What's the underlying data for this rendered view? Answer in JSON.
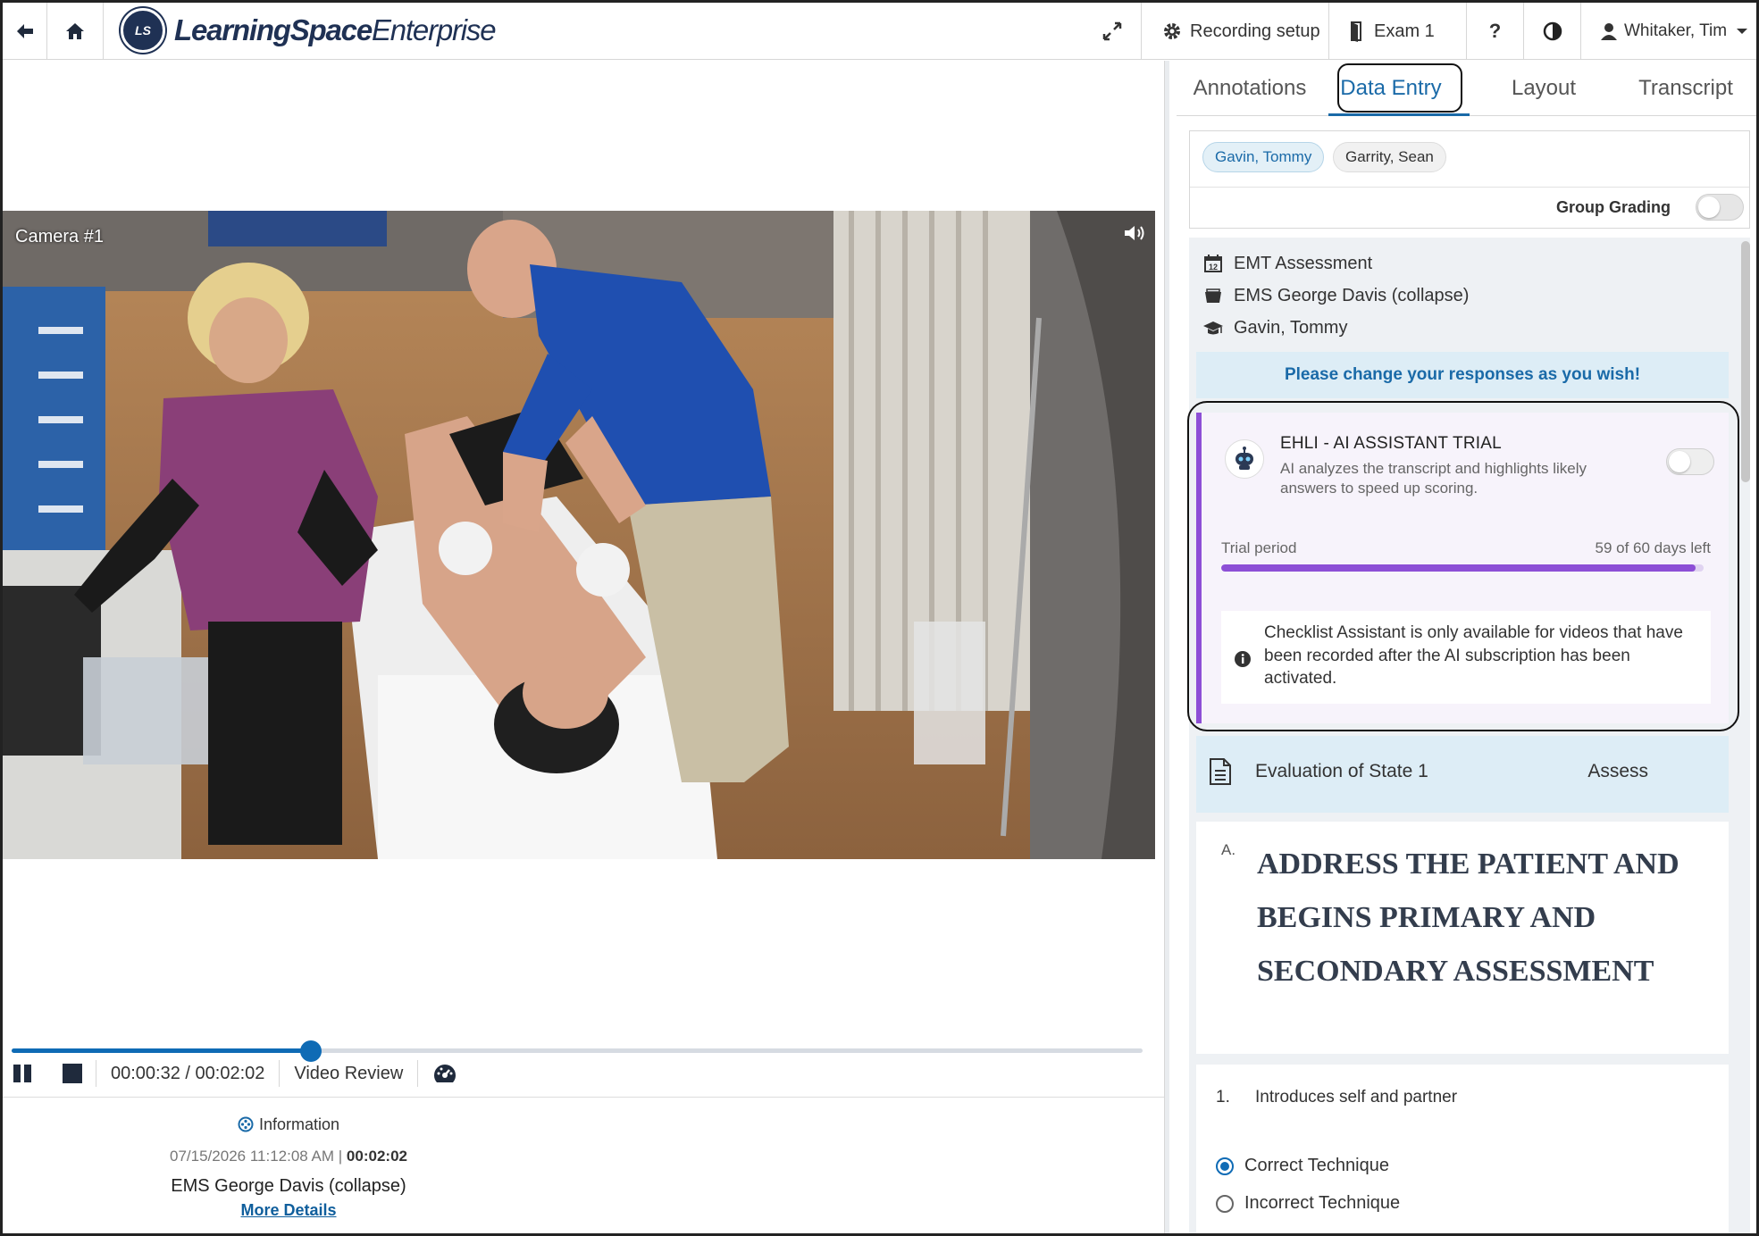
{
  "app": {
    "logo_badge": "LS",
    "logo_name_bold": "LearningSpace",
    "logo_name_light": "Enterprise"
  },
  "topbar": {
    "recording_setup": "Recording setup",
    "exam": "Exam 1",
    "help": "?",
    "user": "Whitaker, Tim"
  },
  "video": {
    "camera_label": "Camera #1",
    "progress": 0.265,
    "time_display": "00:00:32 / 00:02:02",
    "mode": "Video Review"
  },
  "info": {
    "heading": "Information",
    "date": "07/15/2026 11:12:08 AM",
    "separator": "|",
    "duration": "00:02:02",
    "scenario": "EMS George Davis (collapse)",
    "more_details": "More Details"
  },
  "tabs": [
    "Annotations",
    "Data Entry",
    "Layout",
    "Transcript"
  ],
  "students": {
    "chips": [
      "Gavin, Tommy",
      "Garrity, Sean"
    ],
    "group_grading": "Group Grading"
  },
  "meta": {
    "assessment": "EMT Assessment",
    "case": "EMS George Davis (collapse)",
    "learner": "Gavin, Tommy",
    "calendar_day": "12"
  },
  "notice": "Please change your responses as you wish!",
  "ai": {
    "title": "EHLI - AI ASSISTANT TRIAL",
    "description": "AI analyzes the transcript and highlights likely answers to speed up scoring.",
    "trial_label": "Trial period",
    "trial_status": "59 of 60 days left",
    "trial_progress": 0.983,
    "note": "Checklist Assistant is only available for videos that have been recorded after the AI subscription has been activated."
  },
  "section": {
    "title": "Evaluation of State 1",
    "assess": "Assess"
  },
  "question": {
    "letter": "A.",
    "text": "ADDRESS THE PATIENT AND BEGINS PRIMARY AND SECONDARY ASSESSMENT"
  },
  "item": {
    "number": "1.",
    "text": "Introduces self and partner",
    "options": [
      "Correct Technique",
      "Incorrect Technique"
    ],
    "selected": 0
  },
  "colors": {
    "brand": "#1f3154",
    "accent": "#0f6bb5",
    "ai_purple": "#8d4fd6"
  }
}
